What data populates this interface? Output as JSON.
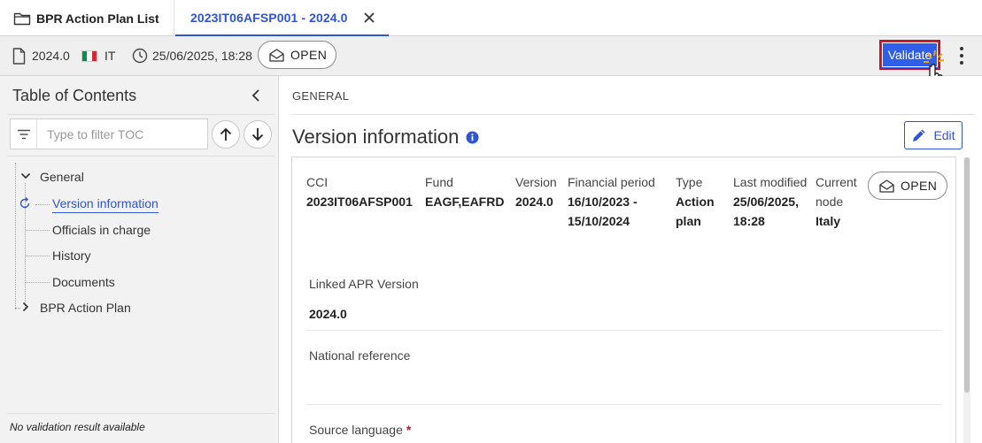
{
  "tabs": [
    {
      "label": "BPR Action Plan List"
    },
    {
      "label": "2023IT06AFSP001 - 2024.0"
    }
  ],
  "toolbar": {
    "version": "2024.0",
    "country": "IT",
    "datetime": "25/06/2025, 18:28",
    "status": "OPEN",
    "validate_label": "Validate"
  },
  "sidebar": {
    "title": "Table of Contents",
    "filter_placeholder": "Type to filter TOC",
    "tree": {
      "general": "General",
      "version_info": "Version information",
      "officials": "Officials in charge",
      "history": "History",
      "documents": "Documents",
      "action_plan": "BPR Action Plan"
    },
    "footer": "No validation result available"
  },
  "main": {
    "section": "GENERAL",
    "title": "Version information",
    "edit_label": "Edit",
    "fields": {
      "cci": {
        "label": "CCI",
        "value": "2023IT06AFSP001"
      },
      "fund": {
        "label": "Fund",
        "value": "EAGF,EAFRD"
      },
      "version": {
        "label": "Version",
        "value": "2024.0"
      },
      "financial_period": {
        "label": "Financial period",
        "value_1": "16/10/2023 -",
        "value_2": "15/10/2024"
      },
      "type": {
        "label": "Type",
        "value_1": "Action",
        "value_2": "plan"
      },
      "last_modified": {
        "label": "Last modified",
        "value_1": "25/06/2025,",
        "value_2": "18:28"
      },
      "current_node": {
        "label_1": "Current",
        "label_2": "node",
        "value": "Italy"
      },
      "status": "OPEN",
      "linked_apr": {
        "label": "Linked APR Version",
        "value": "2024.0"
      },
      "national_ref": {
        "label": "National reference",
        "value": ""
      },
      "source_language": {
        "label": "Source language",
        "required": "*"
      }
    }
  },
  "colors": {
    "accent": "#2f54d4",
    "validate_bg": "#2f5fe8",
    "validate_border": "#c4112a"
  }
}
